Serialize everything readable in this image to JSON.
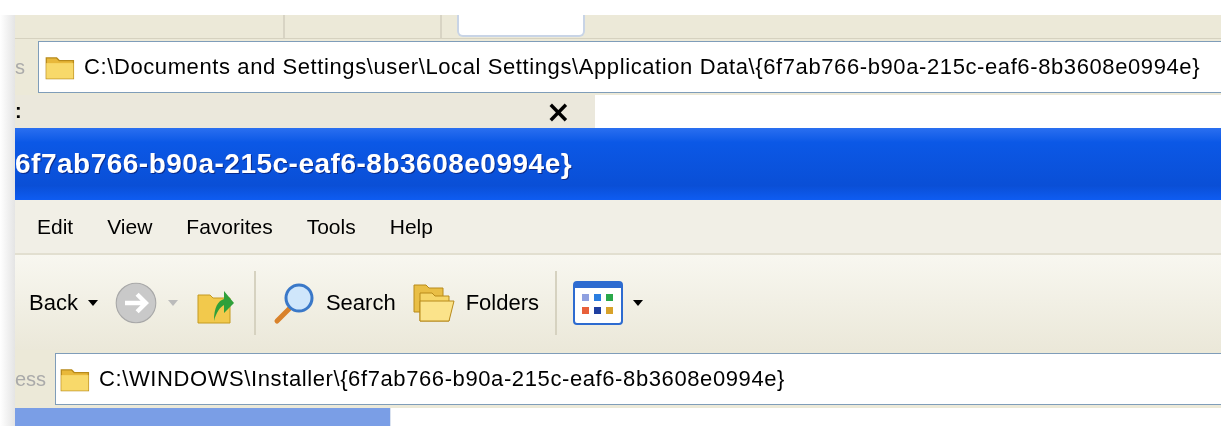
{
  "back_window": {
    "address_label": "s",
    "address": "C:\\Documents and Settings\\user\\Local Settings\\Application Data\\{6f7ab766-b90a-215c-eaf6-8b3608e0994e}",
    "pane_label": ":",
    "close_glyph": "×"
  },
  "front_window": {
    "title": "6f7ab766-b90a-215c-eaf6-8b3608e0994e}",
    "menu": [
      "Edit",
      "View",
      "Favorites",
      "Tools",
      "Help"
    ],
    "toolbar": [
      {
        "kind": "back",
        "label": "Back",
        "disabled": false
      },
      {
        "kind": "forward",
        "disabled": true
      },
      {
        "kind": "up",
        "disabled": false
      },
      {
        "kind": "search",
        "label": "Search",
        "disabled": false
      },
      {
        "kind": "folders",
        "label": "Folders",
        "disabled": false
      },
      {
        "kind": "views",
        "disabled": false
      }
    ],
    "address_label": "ess",
    "address": "C:\\WINDOWS\\Installer\\{6f7ab766-b90a-215c-eaf6-8b3608e0994e}"
  }
}
